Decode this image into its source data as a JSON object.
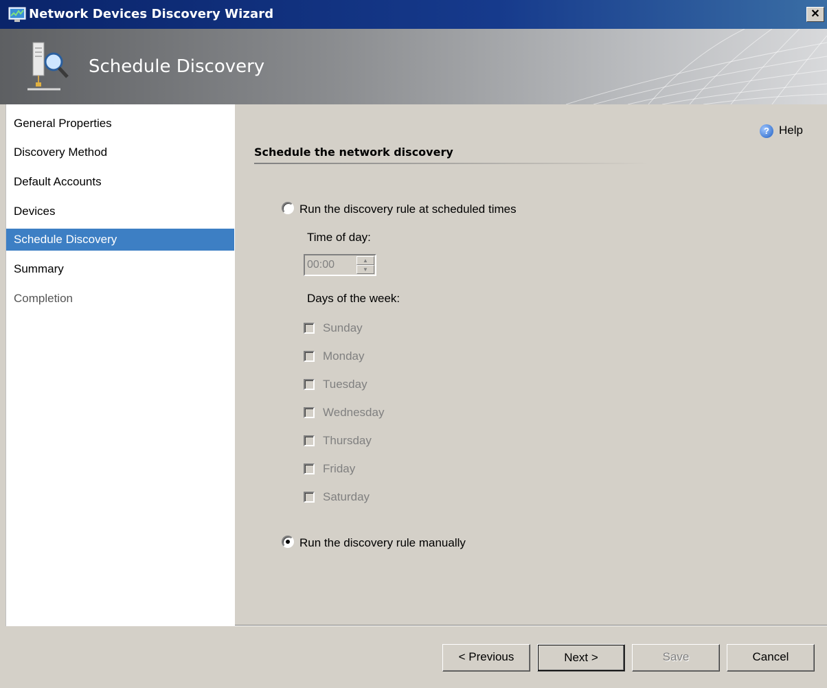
{
  "window": {
    "title": "Network Devices Discovery Wizard",
    "close_label": "✕"
  },
  "banner": {
    "heading": "Schedule Discovery"
  },
  "nav": {
    "items": [
      {
        "label": "General Properties"
      },
      {
        "label": "Discovery Method"
      },
      {
        "label": "Default Accounts"
      },
      {
        "label": "Devices"
      },
      {
        "label": "Schedule Discovery",
        "selected": true
      },
      {
        "label": "Summary"
      },
      {
        "label": "Completion",
        "disabled": true
      }
    ]
  },
  "content": {
    "help_label": "Help",
    "section_title": "Schedule the network discovery",
    "radio_scheduled": {
      "label": "Run the discovery rule at scheduled times",
      "checked": false
    },
    "time_of_day_label": "Time of day:",
    "time_value": "00:00",
    "days_label": "Days of the week:",
    "days": [
      "Sunday",
      "Monday",
      "Tuesday",
      "Wednesday",
      "Thursday",
      "Friday",
      "Saturday"
    ],
    "radio_manual": {
      "label": "Run the discovery rule manually",
      "checked": true
    }
  },
  "footer": {
    "previous_label": "< Previous",
    "next_label": "Next >",
    "save_label": "Save",
    "cancel_label": "Cancel"
  },
  "colors": {
    "selected_nav": "#3d7fc4",
    "title_bar": "#0a246a",
    "dialog_bg": "#d4d0c8"
  }
}
